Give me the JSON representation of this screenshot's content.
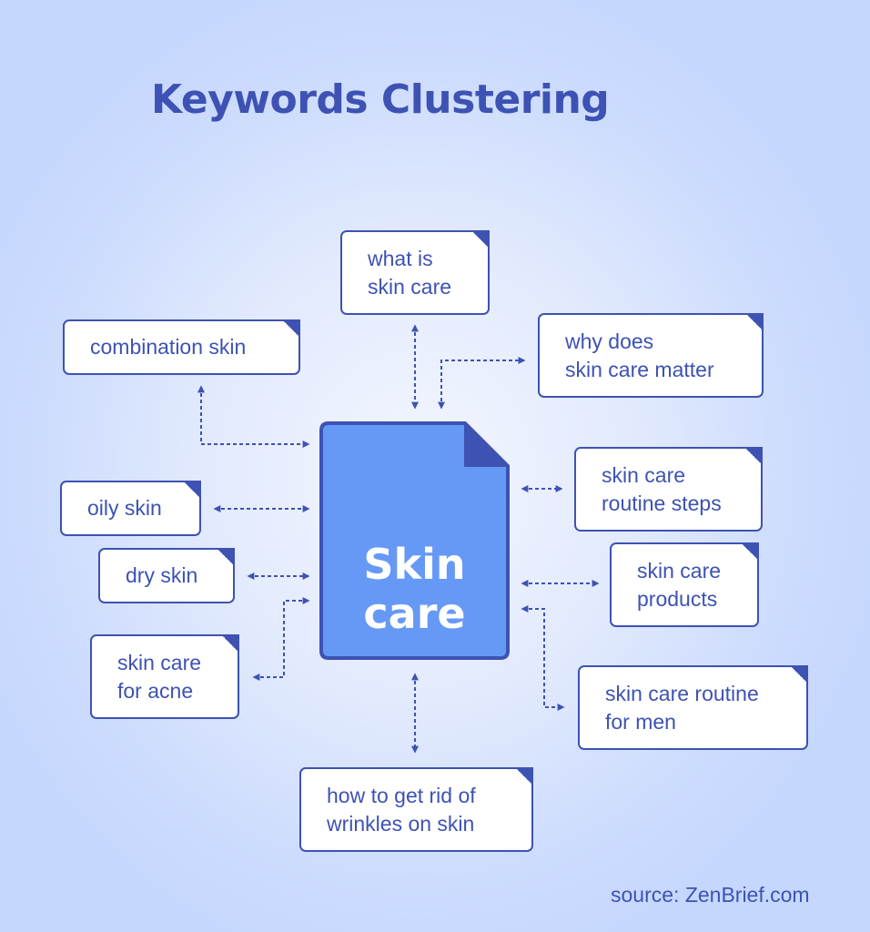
{
  "title": "Keywords Clustering",
  "center": {
    "line1": "Skin",
    "line2": "care"
  },
  "keywords": [
    {
      "id": "what-is-skin-care",
      "lines": [
        "what is",
        "skin care"
      ]
    },
    {
      "id": "combination-skin",
      "lines": [
        "combination skin"
      ]
    },
    {
      "id": "why-does-skin-care-matter",
      "lines": [
        "why does",
        "skin care matter"
      ]
    },
    {
      "id": "oily-skin",
      "lines": [
        "oily skin"
      ]
    },
    {
      "id": "skin-care-routine-steps",
      "lines": [
        "skin care",
        "routine steps"
      ]
    },
    {
      "id": "dry-skin",
      "lines": [
        "dry skin"
      ]
    },
    {
      "id": "skin-care-products",
      "lines": [
        "skin care",
        "products"
      ]
    },
    {
      "id": "skin-care-for-acne",
      "lines": [
        "skin care",
        "for acne"
      ]
    },
    {
      "id": "skin-care-routine-for-men",
      "lines": [
        "skin care routine",
        "for men"
      ]
    },
    {
      "id": "how-to-get-rid-of-wrinkles",
      "lines": [
        "how to get rid of",
        "wrinkles on skin"
      ]
    }
  ],
  "source": "source: ZenBrief.com",
  "colors": {
    "accent": "#3d52b3",
    "center_fill": "#6699f5",
    "card_fill": "#ffffff"
  }
}
